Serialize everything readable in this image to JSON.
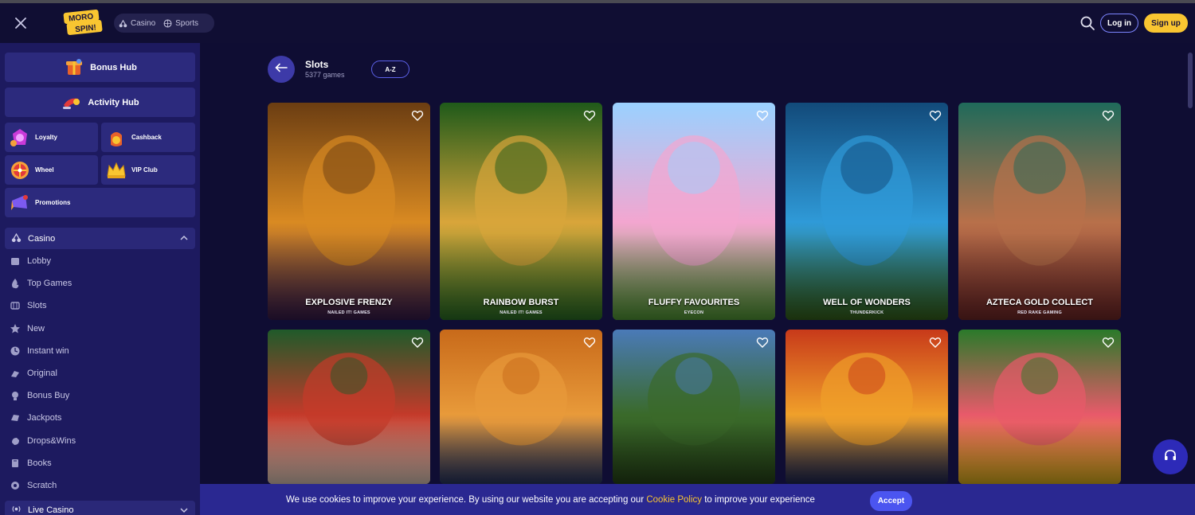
{
  "header": {
    "logo_text": "MORO SPIN!",
    "toggle": {
      "casino": "Casino",
      "sports": "Sports"
    },
    "login_label": "Log in",
    "signup_label": "Sign up"
  },
  "sidebar": {
    "hubs": [
      {
        "label": "Bonus Hub",
        "icon": "bonus-hub-icon"
      },
      {
        "label": "Activity Hub",
        "icon": "activity-hub-icon"
      }
    ],
    "tiles": [
      {
        "label": "Loyalty",
        "icon": "loyalty-icon"
      },
      {
        "label": "Cashback",
        "icon": "cashback-icon"
      },
      {
        "label": "Wheel",
        "icon": "wheel-icon"
      },
      {
        "label": "VIP Club",
        "icon": "crown-icon"
      },
      {
        "label": "Promotions",
        "icon": "promotions-icon"
      }
    ],
    "casino_section": "Casino",
    "nav": [
      {
        "label": "Lobby",
        "icon": "lobby-icon"
      },
      {
        "label": "Top Games",
        "icon": "flame-icon"
      },
      {
        "label": "Slots",
        "icon": "slots-icon"
      },
      {
        "label": "New",
        "icon": "star-icon"
      },
      {
        "label": "Instant win",
        "icon": "instant-win-icon"
      },
      {
        "label": "Original",
        "icon": "original-icon"
      },
      {
        "label": "Bonus Buy",
        "icon": "bonus-buy-icon"
      },
      {
        "label": "Jackpots",
        "icon": "jackpots-icon"
      },
      {
        "label": "Drops&Wins",
        "icon": "drops-wins-icon"
      },
      {
        "label": "Books",
        "icon": "books-icon"
      },
      {
        "label": "Scratch",
        "icon": "scratch-icon"
      }
    ],
    "live_section": "Live Casino"
  },
  "main": {
    "title": "Slots",
    "count": "5377 games",
    "sort_label": "A-Z",
    "games": [
      {
        "name": "EXPLOSIVE FRENZY",
        "provider": "NAILED IT! GAMES",
        "colors": [
          "#6b3d12",
          "#d98a22",
          "#3a1c52"
        ]
      },
      {
        "name": "RAINBOW BURST",
        "provider": "NAILED IT! GAMES",
        "colors": [
          "#1f5a1a",
          "#d9a53a",
          "#2f7a28"
        ]
      },
      {
        "name": "FLUFFY FAVOURITES",
        "provider": "EYECON",
        "colors": [
          "#9ad1ff",
          "#f3a6d0",
          "#5aa83a"
        ]
      },
      {
        "name": "WELL OF WONDERS",
        "provider": "THUNDERKICK",
        "colors": [
          "#124a7a",
          "#2f9ad8",
          "#3a6b1c"
        ]
      },
      {
        "name": "AZTECA GOLD COLLECT",
        "provider": "RED RAKE GAMING",
        "colors": [
          "#1f6a5a",
          "#b8704a",
          "#7a2a2a"
        ]
      },
      {
        "name": "",
        "provider": "",
        "colors": [
          "#1f5a2a",
          "#c43a2a",
          "#f0d8c8"
        ]
      },
      {
        "name": "",
        "provider": "",
        "colors": [
          "#c86a1a",
          "#e89a3a",
          "#2a3a6a"
        ]
      },
      {
        "name": "",
        "provider": "",
        "colors": [
          "#4a7ab8",
          "#3a6a2a",
          "#2a4a1a"
        ]
      },
      {
        "name": "",
        "provider": "",
        "colors": [
          "#c83a1a",
          "#f0a02a",
          "#1f2a5a"
        ]
      },
      {
        "name": "",
        "provider": "",
        "colors": [
          "#2a7a2a",
          "#e85a6a",
          "#f0c020"
        ]
      }
    ]
  },
  "cookie": {
    "text_before": "We use cookies to improve your experience. By using our website you are accepting our ",
    "policy_link": "Cookie Policy",
    "text_after": " to improve your experience",
    "accept_label": "Accept"
  }
}
